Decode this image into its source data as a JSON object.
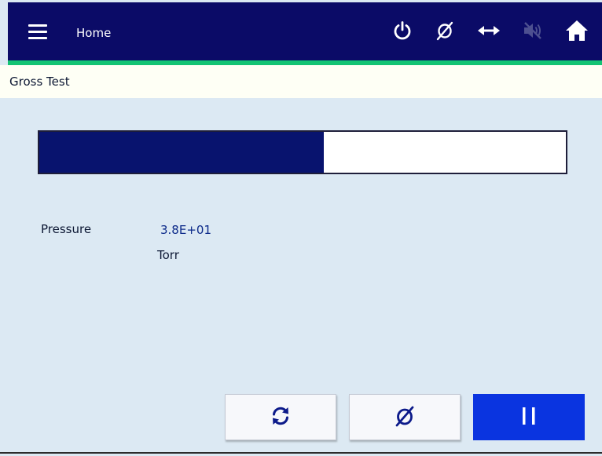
{
  "header": {
    "title": "Home",
    "icons": [
      "menu-icon",
      "power-icon",
      "zero-icon",
      "horizontal-arrows-icon",
      "speaker-muted-icon",
      "home-icon"
    ]
  },
  "subheader": {
    "title": "Gross Test"
  },
  "progress": {
    "fraction": 0.54
  },
  "reading": {
    "label": "Pressure",
    "value": "3.8E+01",
    "unit": "Torr"
  },
  "buttons": [
    {
      "icon": "refresh-icon"
    },
    {
      "icon": "zero-icon"
    },
    {
      "icon": "pause-icon"
    }
  ],
  "colors": {
    "header": "#0b0b67",
    "accent": "#13c474",
    "progress_fill": "#08136e",
    "primary_button": "#0a34e0",
    "background": "#dce9f3"
  }
}
